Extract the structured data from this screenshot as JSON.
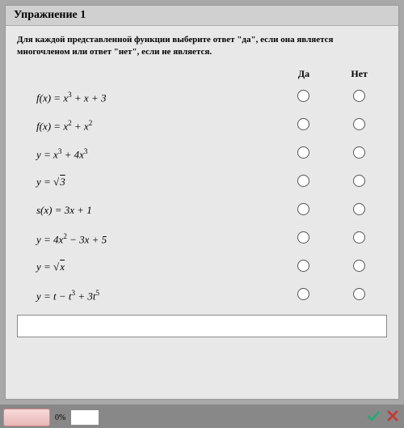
{
  "title": "Упражнение 1",
  "instructions": "Для каждой представленной функции выберите ответ \"да\", если она является многочленом или ответ \"нет\", если не является.",
  "columns": {
    "yes": "Да",
    "no": "Нет"
  },
  "rows": [
    {
      "expr_html": "f(x) = x<sup>3</sup> + x + 3"
    },
    {
      "expr_html": "f(x) = x<sup>2</sup> + x<sup>2</sup>"
    },
    {
      "expr_html": "y = x<sup>3</sup> + 4x<sup>3</sup>"
    },
    {
      "expr_html": "y = √<span class='sqrt'>3</span>"
    },
    {
      "expr_html": "s(x) = 3x + 1"
    },
    {
      "expr_html": "y = 4x<sup>2</sup> − 3x + 5"
    },
    {
      "expr_html": "y = √<span class='sqrt'>x</span>"
    },
    {
      "expr_html": "y = t − t<sup>3</sup> + 3t<sup>5</sup>"
    }
  ],
  "bottom": {
    "percent": "0%"
  }
}
